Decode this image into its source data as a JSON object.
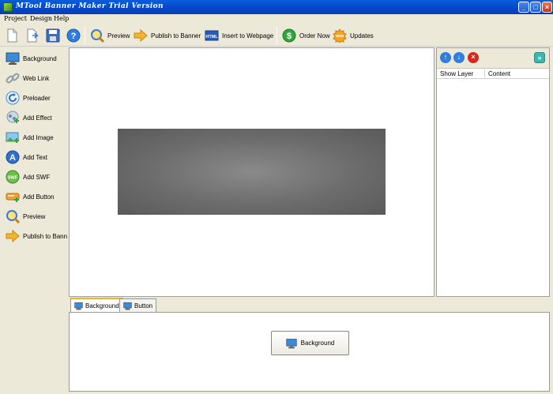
{
  "window": {
    "title": "MTool Banner Maker Trial Version"
  },
  "menu": [
    {
      "label": "Project"
    },
    {
      "label": "Design"
    },
    {
      "label": "Help"
    }
  ],
  "toolbar": {
    "preview": "Preview",
    "publish": "Publish to Banner",
    "insert": "Insert to Webpage",
    "order": "Order Now",
    "updates": "Updates"
  },
  "sidebar": {
    "items": [
      {
        "label": "Background",
        "icon": "monitor-icon"
      },
      {
        "label": "Web Link",
        "icon": "chain-link-icon"
      },
      {
        "label": "Preloader",
        "icon": "refresh-icon"
      },
      {
        "label": "Add Effect",
        "icon": "effect-icon"
      },
      {
        "label": "Add Image",
        "icon": "image-icon"
      },
      {
        "label": "Add Text",
        "icon": "text-icon"
      },
      {
        "label": "Add SWF",
        "icon": "swf-icon"
      },
      {
        "label": "Add Button",
        "icon": "button-icon"
      },
      {
        "label": "Preview",
        "icon": "magnifier-icon"
      },
      {
        "label": "Publish to Bann",
        "icon": "arrow-right-icon"
      }
    ]
  },
  "layers": {
    "columns": [
      "Show Layer",
      "Content"
    ]
  },
  "bottom": {
    "tabs": [
      {
        "label": "Background",
        "active": true
      },
      {
        "label": "Button",
        "active": false
      }
    ],
    "action_button": "Background"
  },
  "colors": {
    "titlebar": "#0446c8",
    "banner": "#6c6c6c",
    "tab_accent": "#f0b030"
  }
}
